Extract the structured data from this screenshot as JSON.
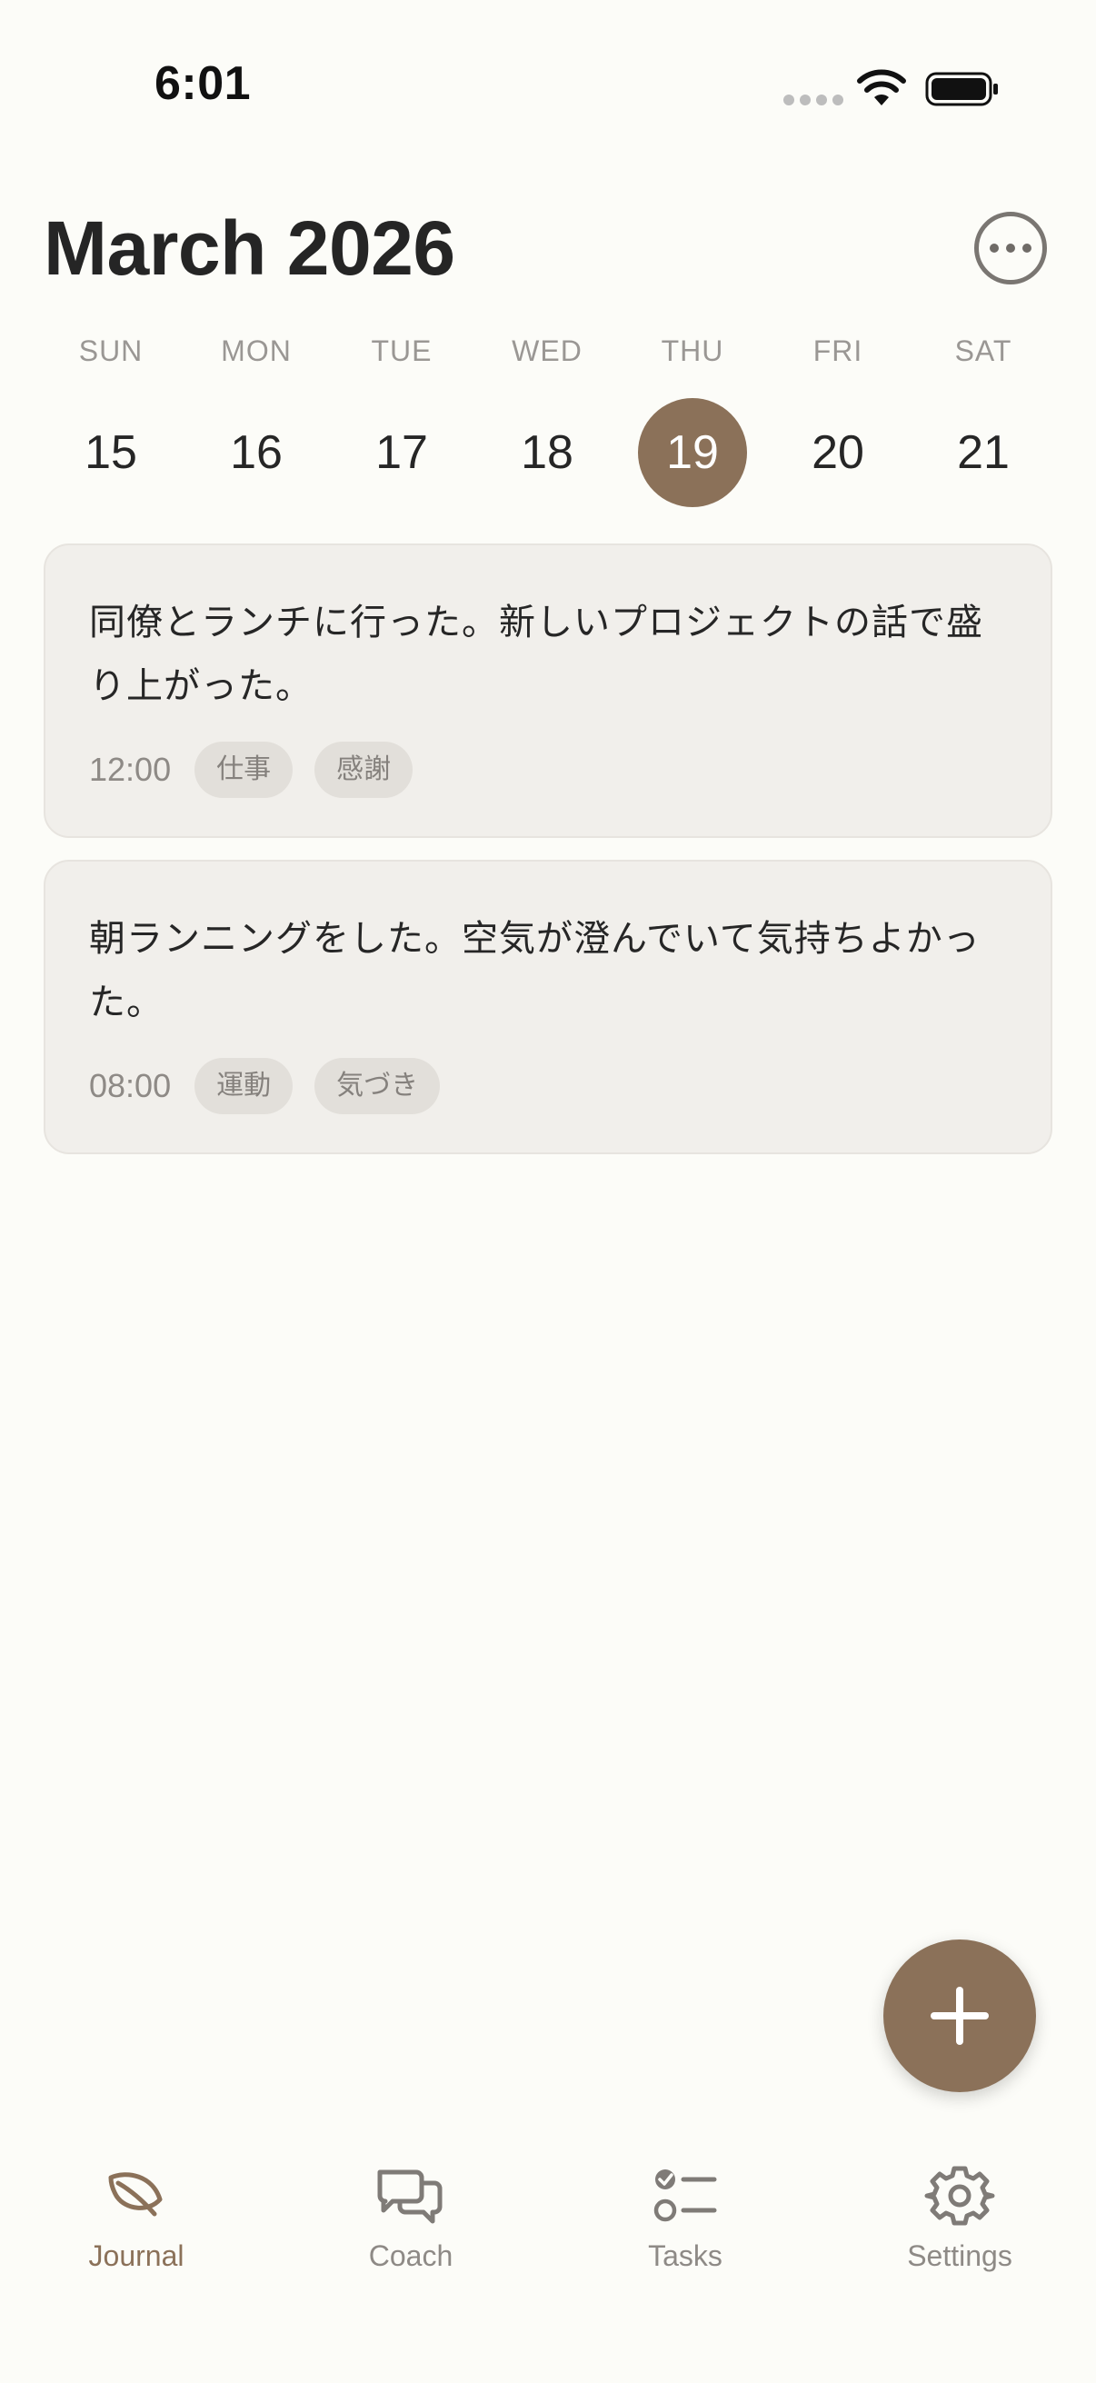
{
  "status_bar": {
    "time": "6:01"
  },
  "header": {
    "title": "March 2026"
  },
  "week": {
    "days": [
      {
        "label": "SUN",
        "number": "15"
      },
      {
        "label": "MON",
        "number": "16"
      },
      {
        "label": "TUE",
        "number": "17"
      },
      {
        "label": "WED",
        "number": "18"
      },
      {
        "label": "THU",
        "number": "19"
      },
      {
        "label": "FRI",
        "number": "20"
      },
      {
        "label": "SAT",
        "number": "21"
      }
    ],
    "selected_day": "19"
  },
  "entries": [
    {
      "text": "同僚とランチに行った。新しいプロジェクトの話で盛り上がった。",
      "time": "12:00",
      "tags": [
        "仕事",
        "感謝"
      ]
    },
    {
      "text": "朝ランニングをした。空気が澄んでいて気持ちよかった。",
      "time": "08:00",
      "tags": [
        "運動",
        "気づき"
      ]
    }
  ],
  "tabs": [
    {
      "label": "Journal",
      "icon": "leaf-icon",
      "active": true
    },
    {
      "label": "Coach",
      "icon": "chat-bubbles-icon",
      "active": false
    },
    {
      "label": "Tasks",
      "icon": "checklist-icon",
      "active": false
    },
    {
      "label": "Settings",
      "icon": "gear-icon",
      "active": false
    }
  ],
  "colors": {
    "accent": "#8B7159",
    "background": "#FCFCF8",
    "card": "#F1EFEB",
    "tag": "#E2DFDA",
    "muted_text": "#8E8A86"
  }
}
